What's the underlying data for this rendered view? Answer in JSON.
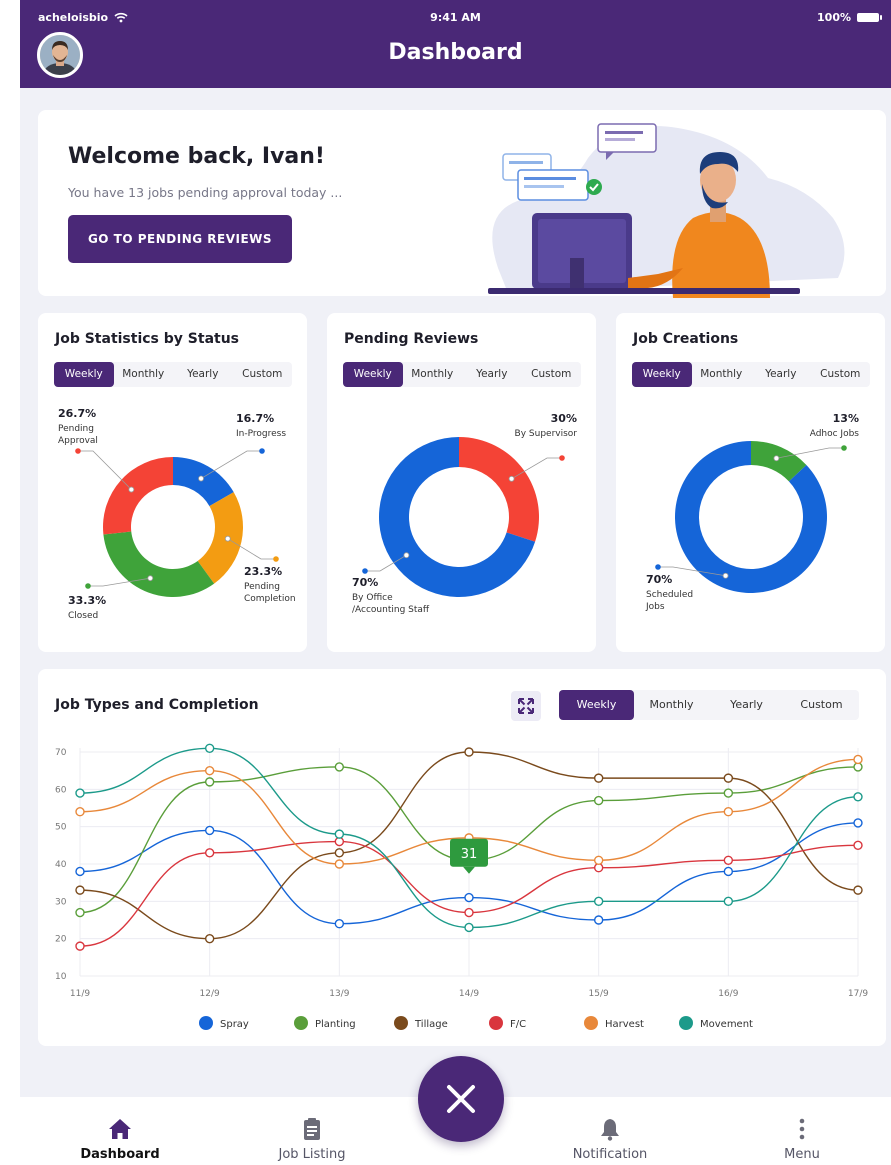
{
  "status_bar": {
    "carrier": "acheloisbio",
    "time": "9:41 AM",
    "battery": "100%"
  },
  "header": {
    "title": "Dashboard"
  },
  "welcome": {
    "title": "Welcome back, Ivan!",
    "subtitle": "You have 13 jobs pending approval today ...",
    "cta": "GO TO PENDING REVIEWS"
  },
  "period_tabs": [
    "Weekly",
    "Monthly",
    "Yearly",
    "Custom"
  ],
  "colors": {
    "brand": "#4a2877",
    "blue": "#1565d8",
    "red": "#f44336",
    "green": "#3fa33a",
    "orange": "#f39c12"
  },
  "stats": [
    {
      "title": "Job Statistics by Status",
      "segments": [
        {
          "value": 16.7,
          "pct": "16.7%",
          "label": "In-Progress",
          "color": "#1565d8"
        },
        {
          "value": 23.3,
          "pct": "23.3%",
          "label": "Pending\nCompletion",
          "color": "#f39c12"
        },
        {
          "value": 33.3,
          "pct": "33.3%",
          "label": "Closed",
          "color": "#3fa33a"
        },
        {
          "value": 26.7,
          "pct": "26.7%",
          "label": "Pending\nApproval",
          "color": "#f44336"
        }
      ]
    },
    {
      "title": "Pending Reviews",
      "segments": [
        {
          "value": 30,
          "pct": "30%",
          "label": "By Supervisor",
          "color": "#f44336"
        },
        {
          "value": 70,
          "pct": "70%",
          "label": "By Office\n/Accounting Staff",
          "color": "#1565d8"
        }
      ]
    },
    {
      "title": "Job Creations",
      "segments": [
        {
          "value": 13,
          "pct": "13%",
          "label": "Adhoc Jobs",
          "color": "#3fa33a"
        },
        {
          "value": 70,
          "pct": "70%",
          "label": "Scheduled\nJobs",
          "color": "#1565d8",
          "visual_share": 87
        }
      ]
    }
  ],
  "line_chart": {
    "title": "Job Types and Completion",
    "chart_data": {
      "type": "line",
      "x": [
        "11/9",
        "12/9",
        "13/9",
        "14/9",
        "15/9",
        "16/9",
        "17/9"
      ],
      "yticks": [
        10,
        20,
        30,
        40,
        50,
        60,
        70
      ],
      "ylim": [
        10,
        70
      ],
      "series": [
        {
          "name": "Spray",
          "color": "#1565d8",
          "values": [
            38,
            49,
            24,
            31,
            25,
            38,
            51
          ]
        },
        {
          "name": "Planting",
          "color": "#5a9e3a",
          "values": [
            27,
            62,
            66,
            41,
            57,
            59,
            66
          ]
        },
        {
          "name": "Tillage",
          "color": "#7a4a1c",
          "values": [
            33,
            20,
            43,
            70,
            63,
            63,
            33
          ]
        },
        {
          "name": "F/C",
          "color": "#d9363e",
          "values": [
            18,
            43,
            46,
            27,
            39,
            41,
            45
          ]
        },
        {
          "name": "Harvest",
          "color": "#e8883a",
          "values": [
            54,
            65,
            40,
            47,
            41,
            54,
            68
          ]
        },
        {
          "name": "Movement",
          "color": "#1c9a8a",
          "values": [
            59,
            71,
            48,
            23,
            30,
            30,
            58
          ]
        }
      ],
      "tooltip": {
        "value": "31",
        "x_index": 3,
        "at": 43
      },
      "grid": true,
      "legend": "bottom"
    }
  },
  "tabbar": [
    {
      "label": "Dashboard",
      "icon": "home-icon",
      "active": true
    },
    {
      "label": "Job Listing",
      "icon": "clipboard-icon",
      "active": false
    },
    {
      "label": "Notification",
      "icon": "bell-icon",
      "active": false
    },
    {
      "label": "Menu",
      "icon": "more-vertical-icon",
      "active": false
    }
  ],
  "fab": {
    "icon": "close-icon"
  }
}
